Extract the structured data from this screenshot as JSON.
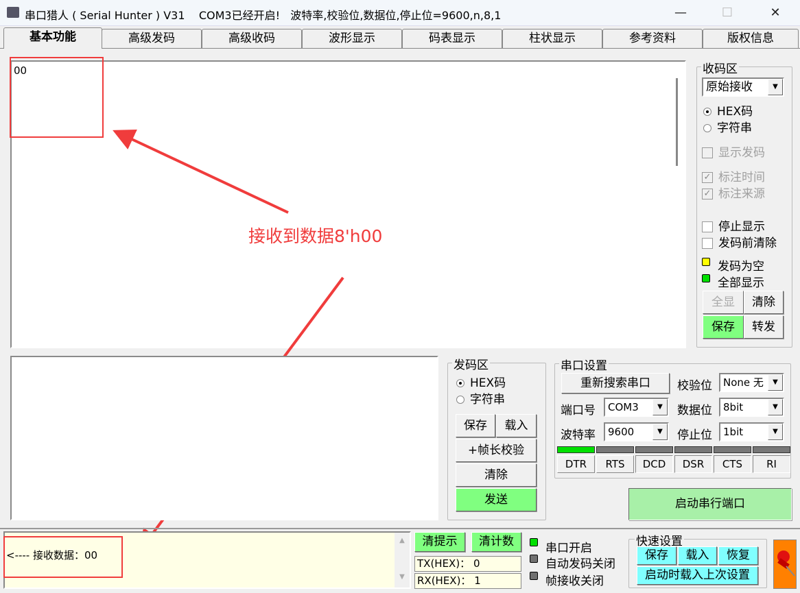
{
  "window": {
    "title": "串口猎人 ( Serial Hunter ) V31    COM3已经开启!   波特率,校验位,数据位,停止位=9600,n,8,1",
    "minimize": "—",
    "maximize": "☐",
    "close": "✕",
    "app_icon": "serial-port-icon"
  },
  "tabs": [
    {
      "label": "基本功能",
      "active": true
    },
    {
      "label": "高级发码"
    },
    {
      "label": "高级收码"
    },
    {
      "label": "波形显示"
    },
    {
      "label": "码表显示"
    },
    {
      "label": "柱状显示"
    },
    {
      "label": "参考资料"
    },
    {
      "label": "版权信息"
    }
  ],
  "receive": {
    "content": "00"
  },
  "annotation": {
    "text": "接收到数据8'h00",
    "color": "#f03c3c"
  },
  "recv_panel": {
    "title": "收码区",
    "mode": "原始接收",
    "radio_hex": "HEX码",
    "radio_str": "字符串",
    "selected": "HEX码",
    "show_send": {
      "label": "显示发码",
      "checked": false,
      "disabled": true
    },
    "mark_time": {
      "label": "标注时间",
      "checked": true,
      "disabled": true
    },
    "mark_source": {
      "label": "标注来源",
      "checked": true,
      "disabled": true
    },
    "stop_display": {
      "label": "停止显示",
      "checked": false
    },
    "clear_before_send": {
      "label": "发码前清除",
      "checked": false
    },
    "led_send_empty": {
      "label": "发码为空",
      "color": "#ffff00"
    },
    "led_show_all": {
      "label": "全部显示",
      "color": "#00e000"
    },
    "btn_show_all": "全显",
    "btn_clear": "清除",
    "btn_save": "保存",
    "btn_forward": "转发"
  },
  "send_panel": {
    "title": "发码区",
    "radio_hex": "HEX码",
    "radio_str": "字符串",
    "selected": "HEX码",
    "btn_save": "保存",
    "btn_load": "载入",
    "btn_frame_check": "+帧长校验",
    "btn_clear": "清除",
    "btn_send": "发送"
  },
  "serial": {
    "title": "串口设置",
    "btn_rescan": "重新搜索串口",
    "port_label": "端口号",
    "port": "COM3",
    "baud_label": "波特率",
    "baud": "9600",
    "parity_label": "校验位",
    "parity": "None 无",
    "databits_label": "数据位",
    "databits": "8bit",
    "stopbits_label": "停止位",
    "stopbits": "1bit",
    "signals": [
      {
        "name": "DTR",
        "on": true
      },
      {
        "name": "RTS",
        "on": false
      },
      {
        "name": "DCD",
        "on": false
      },
      {
        "name": "DSR",
        "on": false
      },
      {
        "name": "CTS",
        "on": false
      },
      {
        "name": "RI",
        "on": false
      }
    ],
    "btn_start": "启动串行端口"
  },
  "status": {
    "message": "<---- 接收数据：00",
    "btn_clear_hint": "清提示",
    "btn_clear_count": "清计数",
    "tx": "TX(HEX)：  0",
    "rx": "RX(HEX)：  1",
    "led_port_open": {
      "label": "串口开启",
      "color": "#00e000"
    },
    "led_auto_send": {
      "label": "自动发码关闭",
      "color": "#707070"
    },
    "led_frame_recv": {
      "label": "帧接收关闭",
      "color": "#707070"
    }
  },
  "quick": {
    "title": "快速设置",
    "btn_save": "保存",
    "btn_load": "载入",
    "btn_restore": "恢复",
    "btn_load_last": "启动时载入上次设置",
    "pin_icon": "pushpin-icon"
  }
}
